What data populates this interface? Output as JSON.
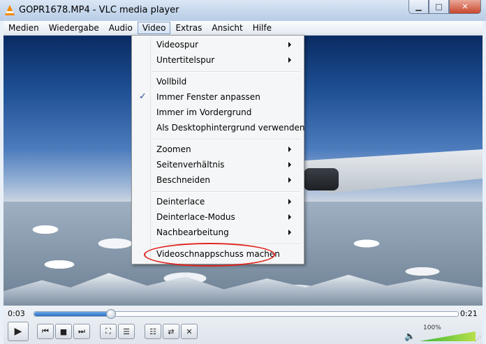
{
  "window": {
    "title": "GOPR1678.MP4 - VLC media player",
    "min_glyph": "▁",
    "max_glyph": "□",
    "close_glyph": "✕"
  },
  "menubar": {
    "items": [
      "Medien",
      "Wiedergabe",
      "Audio",
      "Video",
      "Extras",
      "Ansicht",
      "Hilfe"
    ],
    "active": "Video"
  },
  "video_menu": {
    "items": [
      {
        "label": "Videospur",
        "submenu": true
      },
      {
        "label": "Untertitelspur",
        "submenu": true
      },
      {
        "label": "Vollbild",
        "submenu": false
      },
      {
        "label": "Immer Fenster anpassen",
        "submenu": false,
        "checked": true
      },
      {
        "label": "Immer im Vordergrund",
        "submenu": false
      },
      {
        "label": "Als Desktophintergrund verwenden",
        "submenu": false
      },
      {
        "label": "Zoomen",
        "submenu": true
      },
      {
        "label": "Seitenverhältnis",
        "submenu": true
      },
      {
        "label": "Beschneiden",
        "submenu": true
      },
      {
        "label": "Deinterlace",
        "submenu": true
      },
      {
        "label": "Deinterlace-Modus",
        "submenu": true
      },
      {
        "label": "Nachbearbeitung",
        "submenu": true
      },
      {
        "label": "Videoschnappschuss machen",
        "submenu": false,
        "highlighted_annotation": true
      }
    ],
    "check_glyph": "✓",
    "annotation_color": "#e0231e"
  },
  "controls": {
    "elapsed": "0:03",
    "total": "0:21",
    "progress": 0.18,
    "volume_label": "100%",
    "volume_level": 1.0,
    "buttons": {
      "play": "▶",
      "prev": "⏮",
      "stop": "■",
      "next": "⏭",
      "fullscreen": "⛶",
      "extended": "☰",
      "playlist": "☷",
      "loop": "⇄",
      "shuffle": "✕"
    },
    "speaker_glyph": "🔈"
  },
  "colors": {
    "seek_fill": "#2b6fc1",
    "volume_fill": "#38b735",
    "vlc_orange": "#f18a00"
  }
}
